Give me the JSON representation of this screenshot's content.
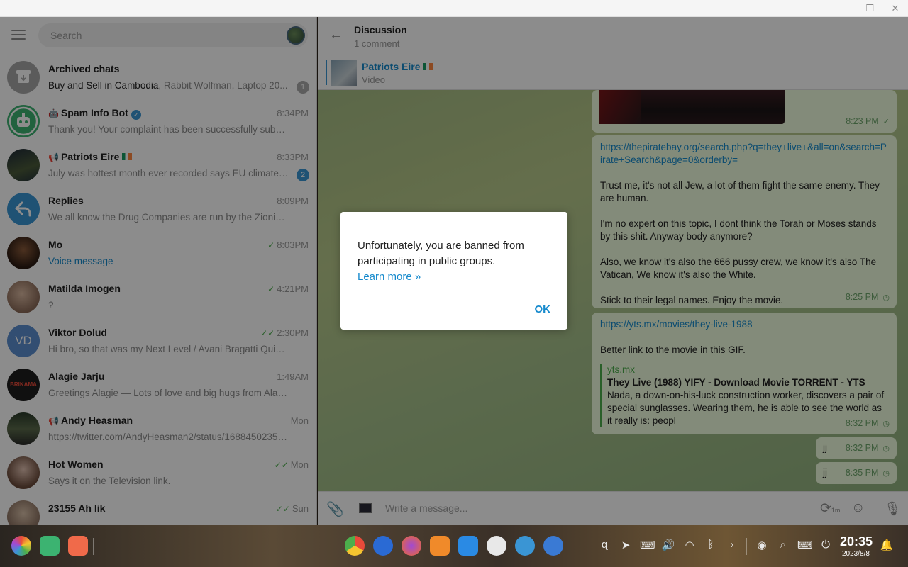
{
  "window": {
    "minimize": "—",
    "maximize": "❐",
    "close": "✕"
  },
  "sidebar": {
    "search_placeholder": "Search",
    "chats": [
      {
        "name": "Archived chats",
        "preview_highlight": "Buy and Sell in Cambodia",
        "preview": ", Rabbit Wolfman, Laptop 20...",
        "badge": "1"
      },
      {
        "name": "Spam Info Bot",
        "time": "8:34PM",
        "preview": "Thank you! Your complaint has been successfully submitte..."
      },
      {
        "name": "Patriots Eire",
        "time": "8:33PM",
        "preview": "July was hottest month ever recorded says EU climate o...",
        "badge": "2"
      },
      {
        "name": "Replies",
        "time": "8:09PM",
        "preview": "We all know the Drug Companies are run by the Zionistz Je..."
      },
      {
        "name": "Mo",
        "time": "8:03PM",
        "preview": "Voice message"
      },
      {
        "name": "Matilda Imogen",
        "time": "4:21PM",
        "preview": "?"
      },
      {
        "name": "Viktor Dolud",
        "initials": "VD",
        "time": "2:30PM",
        "preview": "Hi bro, so that was my Next Level / Avani Bragatti Quick Bu..."
      },
      {
        "name": "Alagie Jarju",
        "avatar_text": "BRIKAMA",
        "time": "1:49AM",
        "preview": "Greetings Alagie — Lots of love and big hugs from Alagie in ..."
      },
      {
        "name": "Andy Heasman",
        "time": "Mon",
        "preview": "https://twitter.com/AndyHeasman2/status/1688450235586..."
      },
      {
        "name": "Hot Women",
        "time": "Mon",
        "preview": "Says it on the Television link."
      },
      {
        "name": "23155 Ah lik",
        "time": "Sun",
        "preview": ""
      }
    ]
  },
  "header": {
    "title": "Discussion",
    "subtitle": "1 comment"
  },
  "pinned": {
    "title": "Patriots Eire",
    "subtitle": "Video"
  },
  "messages": {
    "m1_time": "8:23 PM",
    "m2_link": "https://thepiratebay.org/search.php?q=they+live+&all=on&search=Pirate+Search&page=0&orderby=",
    "m2_p1": "Trust me, it's not all Jew, a lot of them fight the same enemy. They are human.",
    "m2_p2": "I'm no expert on this topic, I dont think the Torah or Moses stands by this shit. Anyway body anymore?",
    "m2_p3": "Also, we know it's also the 666 pussy crew, we know it's also The Vatican, We know it's also the White.",
    "m2_p4": "Stick to their legal names. Enjoy the movie.",
    "m2_time": "8:25 PM",
    "m3_link": "https://yts.mx/movies/they-live-1988",
    "m3_text": "Better link to the movie in this GIF.",
    "m3_site": "yts.mx",
    "m3_title": "They Live (1988) YIFY - Download Movie TORRENT - YTS",
    "m3_desc": "Nada, a down-on-his-luck construction worker, discovers a pair of special sunglasses. Wearing them, he is able to see the world as it really is: peopl",
    "m3_time": "8:32 PM",
    "m4_text": "jj",
    "m4_time": "8:32 PM",
    "m5_text": "jj",
    "m5_time": "8:35 PM"
  },
  "compose": {
    "placeholder": "Write a message...",
    "timer_label": "1m"
  },
  "dialog": {
    "text": "Unfortunately, you are banned from participating in public groups.",
    "link": "Learn more »",
    "ok": "OK"
  },
  "taskbar": {
    "time": "20:35",
    "date": "2023/8/8"
  },
  "colors": {
    "accent": "#168acd",
    "bubble": "#effdde",
    "sent_check": "#4cae4c"
  }
}
